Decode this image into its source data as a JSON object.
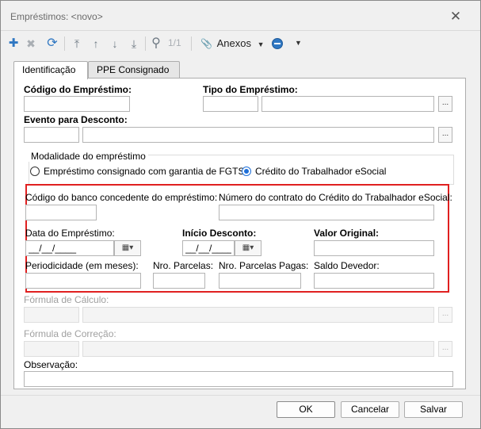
{
  "window": {
    "title": "Empréstimos: <novo>",
    "close": "✕"
  },
  "toolbar": {
    "add": "✚",
    "delete": "✖",
    "refresh": "⟳",
    "first": "⤒",
    "up": "↑",
    "down": "↓",
    "last": "⤓",
    "search": "⚲",
    "page_counter": "1/1",
    "attach_icon": "📎",
    "attachments_label": "Anexos",
    "caret": "▼",
    "extra_caret": "▼"
  },
  "tabs": [
    {
      "label": "Identificação",
      "active": true
    },
    {
      "label": "PPE Consignado",
      "active": false
    }
  ],
  "form": {
    "codigo_emprestimo_label": "Código do Empréstimo:",
    "tipo_emprestimo_label": "Tipo do Empréstimo:",
    "evento_desconto_label": "Evento para Desconto:",
    "lookup_button": "...",
    "modalidade": {
      "title": "Modalidade do empréstimo",
      "options": [
        {
          "label": "Empréstimo consignado com garantia de FGTS",
          "selected": false
        },
        {
          "label": "Crédito do Trabalhador eSocial",
          "selected": true
        }
      ]
    },
    "codigo_banco_label": "Código do banco concedente do empréstimo:",
    "numero_contrato_label": "Número do contrato do Crédito do Trabalhador eSocial:",
    "data_emprestimo_label": "Data do Empréstimo:",
    "data_emprestimo_value": "__/__/____",
    "inicio_desconto_label": "Início Desconto:",
    "inicio_desconto_value": "__/__/____",
    "valor_original_label": "Valor Original:",
    "periodicidade_label": "Periodicidade (em meses):",
    "nro_parcelas_label": "Nro. Parcelas:",
    "nro_parcelas_pagas_label": "Nro. Parcelas Pagas:",
    "saldo_devedor_label": "Saldo Devedor:",
    "formula_calculo_label": "Fórmula de Cálculo:",
    "formula_correcao_label": "Fórmula de Correção:",
    "observacao_label": "Observação:",
    "calendar_icon": "▦▾"
  },
  "footer": {
    "ok": "OK",
    "cancel": "Cancelar",
    "save": "Salvar"
  },
  "colors": {
    "highlight_border": "#e02020",
    "radio_accent": "#1e6fd8",
    "toolbar_blue": "#2f77c2"
  }
}
